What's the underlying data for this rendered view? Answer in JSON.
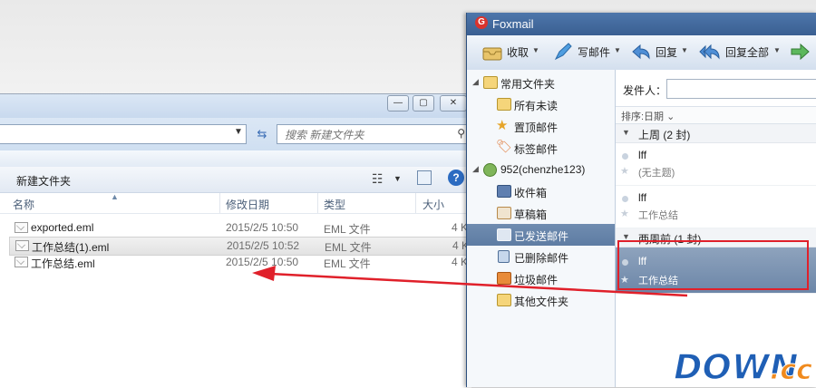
{
  "explorer": {
    "window_buttons": [
      "—",
      "▢",
      "✕"
    ],
    "search": {
      "placeholder": "搜索 新建文件夹"
    },
    "commands": {
      "new_folder": "新建文件夹"
    },
    "columns": [
      "名称",
      "修改日期",
      "类型",
      "大小"
    ],
    "files": [
      {
        "name": "exported.eml",
        "date": "2015/2/5 10:50",
        "type": "EML 文件",
        "size": "4 K"
      },
      {
        "name": "工作总结(1).eml",
        "date": "2015/2/5 10:52",
        "type": "EML 文件",
        "size": "4 K"
      },
      {
        "name": "工作总结.eml",
        "date": "2015/2/5 10:50",
        "type": "EML 文件",
        "size": "4 K"
      }
    ]
  },
  "foxmail": {
    "title": "Foxmail",
    "toolbar": [
      {
        "label": "收取",
        "icon": "inbox-tray-icon"
      },
      {
        "label": "写邮件",
        "icon": "pen-icon"
      },
      {
        "label": "回复",
        "icon": "reply-arrow-icon"
      },
      {
        "label": "回复全部",
        "icon": "reply-all-icon"
      }
    ],
    "folders": [
      {
        "label": "常用文件夹",
        "level": 0,
        "icon": "folder-icon"
      },
      {
        "label": "所有未读",
        "level": 1,
        "icon": "folder-icon"
      },
      {
        "label": "置顶邮件",
        "level": 1,
        "icon": "star-icon"
      },
      {
        "label": "标签邮件",
        "level": 1,
        "icon": "tag-icon"
      },
      {
        "label": "952(chenzhe123)",
        "level": 0,
        "icon": "account-icon"
      },
      {
        "label": "收件箱",
        "level": 1,
        "icon": "inbox-icon"
      },
      {
        "label": "草稿箱",
        "level": 1,
        "icon": "draft-icon"
      },
      {
        "label": "已发送邮件",
        "level": 1,
        "icon": "sent-icon",
        "selected": true
      },
      {
        "label": "已删除邮件",
        "level": 1,
        "icon": "trash-icon"
      },
      {
        "label": "垃圾邮件",
        "level": 1,
        "icon": "spam-icon"
      },
      {
        "label": "其他文件夹",
        "level": 1,
        "icon": "folder-icon"
      }
    ],
    "list": {
      "sender_label": "发件人：",
      "sort_label": "排序:日期 ⌄",
      "groups": [
        {
          "label": "上周 (2 封)",
          "mails": [
            {
              "from": "lff",
              "subject": "(无主题)"
            },
            {
              "from": "lff",
              "subject": "工作总结"
            }
          ]
        },
        {
          "label": "两周前 (1 封)",
          "mails": [
            {
              "from": "lff",
              "subject": "工作总结",
              "selected": true
            }
          ]
        }
      ]
    }
  },
  "watermark": {
    "text": "DOWN",
    "suffix": ".cc"
  },
  "colors": {
    "highlight_box": "#e0202a",
    "arrow": "#e0202a",
    "foxmail_title": "#3a5f92",
    "selected_row": "#6c86a8"
  }
}
